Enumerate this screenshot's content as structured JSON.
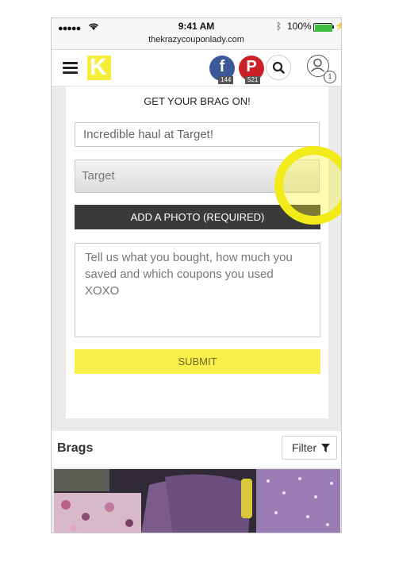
{
  "status_bar": {
    "signal": "●●●●●",
    "time": "9:41 AM",
    "battery": "100%",
    "url": "thekrazycouponlady.com"
  },
  "navbar": {
    "logo_letter": "K",
    "facebook_count": "144",
    "pinterest_count": "521",
    "account_badge": "1",
    "brand_color": "#f6ee3a"
  },
  "brag_form": {
    "title": "GET YOUR BRAG ON!",
    "title_field_value": "Incredible haul at Target!",
    "store_field_value": "Target",
    "photo_button_label": "ADD A PHOTO (REQUIRED)",
    "description_placeholder": "Tell us what you bought, how much you saved and which coupons you used XOXO",
    "submit_label": "SUBMIT"
  },
  "brags": {
    "title": "Brags",
    "filter_label": "Filter"
  }
}
